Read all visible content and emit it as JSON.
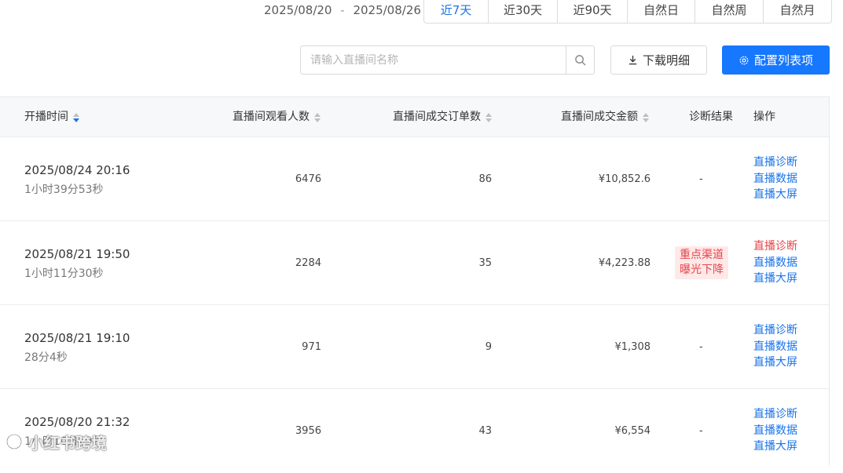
{
  "filter": {
    "date_range_start": "2025/08/20",
    "date_range_sep": "-",
    "date_range_end": "2025/08/26",
    "periods": [
      "近7天",
      "近30天",
      "近90天",
      "自然日",
      "自然周",
      "自然月"
    ],
    "active_period": "近7天"
  },
  "toolbar": {
    "search_placeholder": "请输入直播间名称",
    "search_value": "",
    "download_label": "下载明细",
    "config_label": "配置列表项"
  },
  "table": {
    "headers": {
      "start_time": "开播时间",
      "viewers": "直播间观看人数",
      "orders": "直播间成交订单数",
      "gmv": "直播间成交金额",
      "diagnosis": "诊断结果",
      "ops": "操作"
    },
    "sorted_column": "start_time",
    "sort_direction": "desc",
    "op_labels": [
      "直播诊断",
      "直播数据",
      "直播大屏"
    ],
    "rows": [
      {
        "start": "2025/08/24 20:16",
        "duration": "1小时39分53秒",
        "viewers": "6476",
        "orders": "86",
        "gmv": "¥10,852.6",
        "diagnosis": "-",
        "diagnosis_alert": false
      },
      {
        "start": "2025/08/21 19:50",
        "duration": "1小时11分30秒",
        "viewers": "2284",
        "orders": "35",
        "gmv": "¥4,223.88",
        "diagnosis": [
          "重点渠道",
          "曝光下降"
        ],
        "diagnosis_alert": true
      },
      {
        "start": "2025/08/21 19:10",
        "duration": "28分4秒",
        "viewers": "971",
        "orders": "9",
        "gmv": "¥1,308",
        "diagnosis": "-",
        "diagnosis_alert": false
      },
      {
        "start": "2025/08/20 21:32",
        "duration": "1小时10分29秒",
        "viewers": "3956",
        "orders": "43",
        "gmv": "¥6,554",
        "diagnosis": "-",
        "diagnosis_alert": false
      }
    ]
  },
  "watermark": {
    "text": "小红书跨境"
  },
  "colors": {
    "accent": "#1677ff",
    "link": "#1a73e8",
    "alert": "#e6454a",
    "alert_bg": "#ffe8e8"
  }
}
